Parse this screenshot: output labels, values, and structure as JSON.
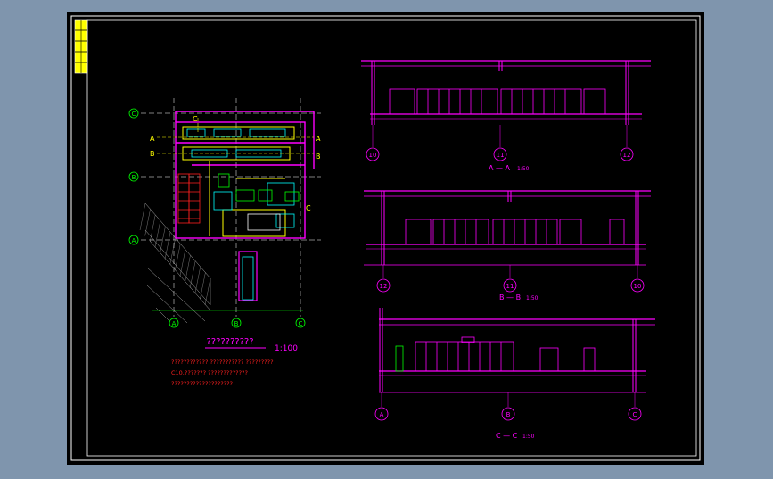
{
  "viewer": {
    "background": "#7f95ad",
    "sheet_color": "#000000",
    "frame_color": "#ffffff"
  },
  "colors": {
    "magenta": "#ff00ff",
    "cyan": "#00ffff",
    "yellow": "#ffff00",
    "green": "#00ff00",
    "red": "#ff2020",
    "white": "#ffffff",
    "hatch": "#b0b0b0"
  },
  "plan": {
    "title": "??????????",
    "scale": "1:100",
    "notes": [
      "???????????? ??????????? ?????????",
      "C10.??????? ?????????????",
      "????????????????????"
    ],
    "row_markers": [
      "C",
      "B",
      "A"
    ],
    "column_markers": [
      "A",
      "B",
      "C"
    ],
    "section_cuts": [
      "A",
      "A",
      "B",
      "B",
      "C",
      "C"
    ]
  },
  "sections": [
    {
      "id": "A-A",
      "title": "A — A",
      "scale": "1:50",
      "axis_labels": [
        "10",
        "11",
        "12"
      ]
    },
    {
      "id": "B-B",
      "title": "B — B",
      "scale": "1:50",
      "axis_labels": [
        "12",
        "11",
        "10"
      ]
    },
    {
      "id": "C-C",
      "title": "C — C",
      "scale": "1:50",
      "axis_labels": [
        "A",
        "B",
        "C"
      ]
    }
  ]
}
